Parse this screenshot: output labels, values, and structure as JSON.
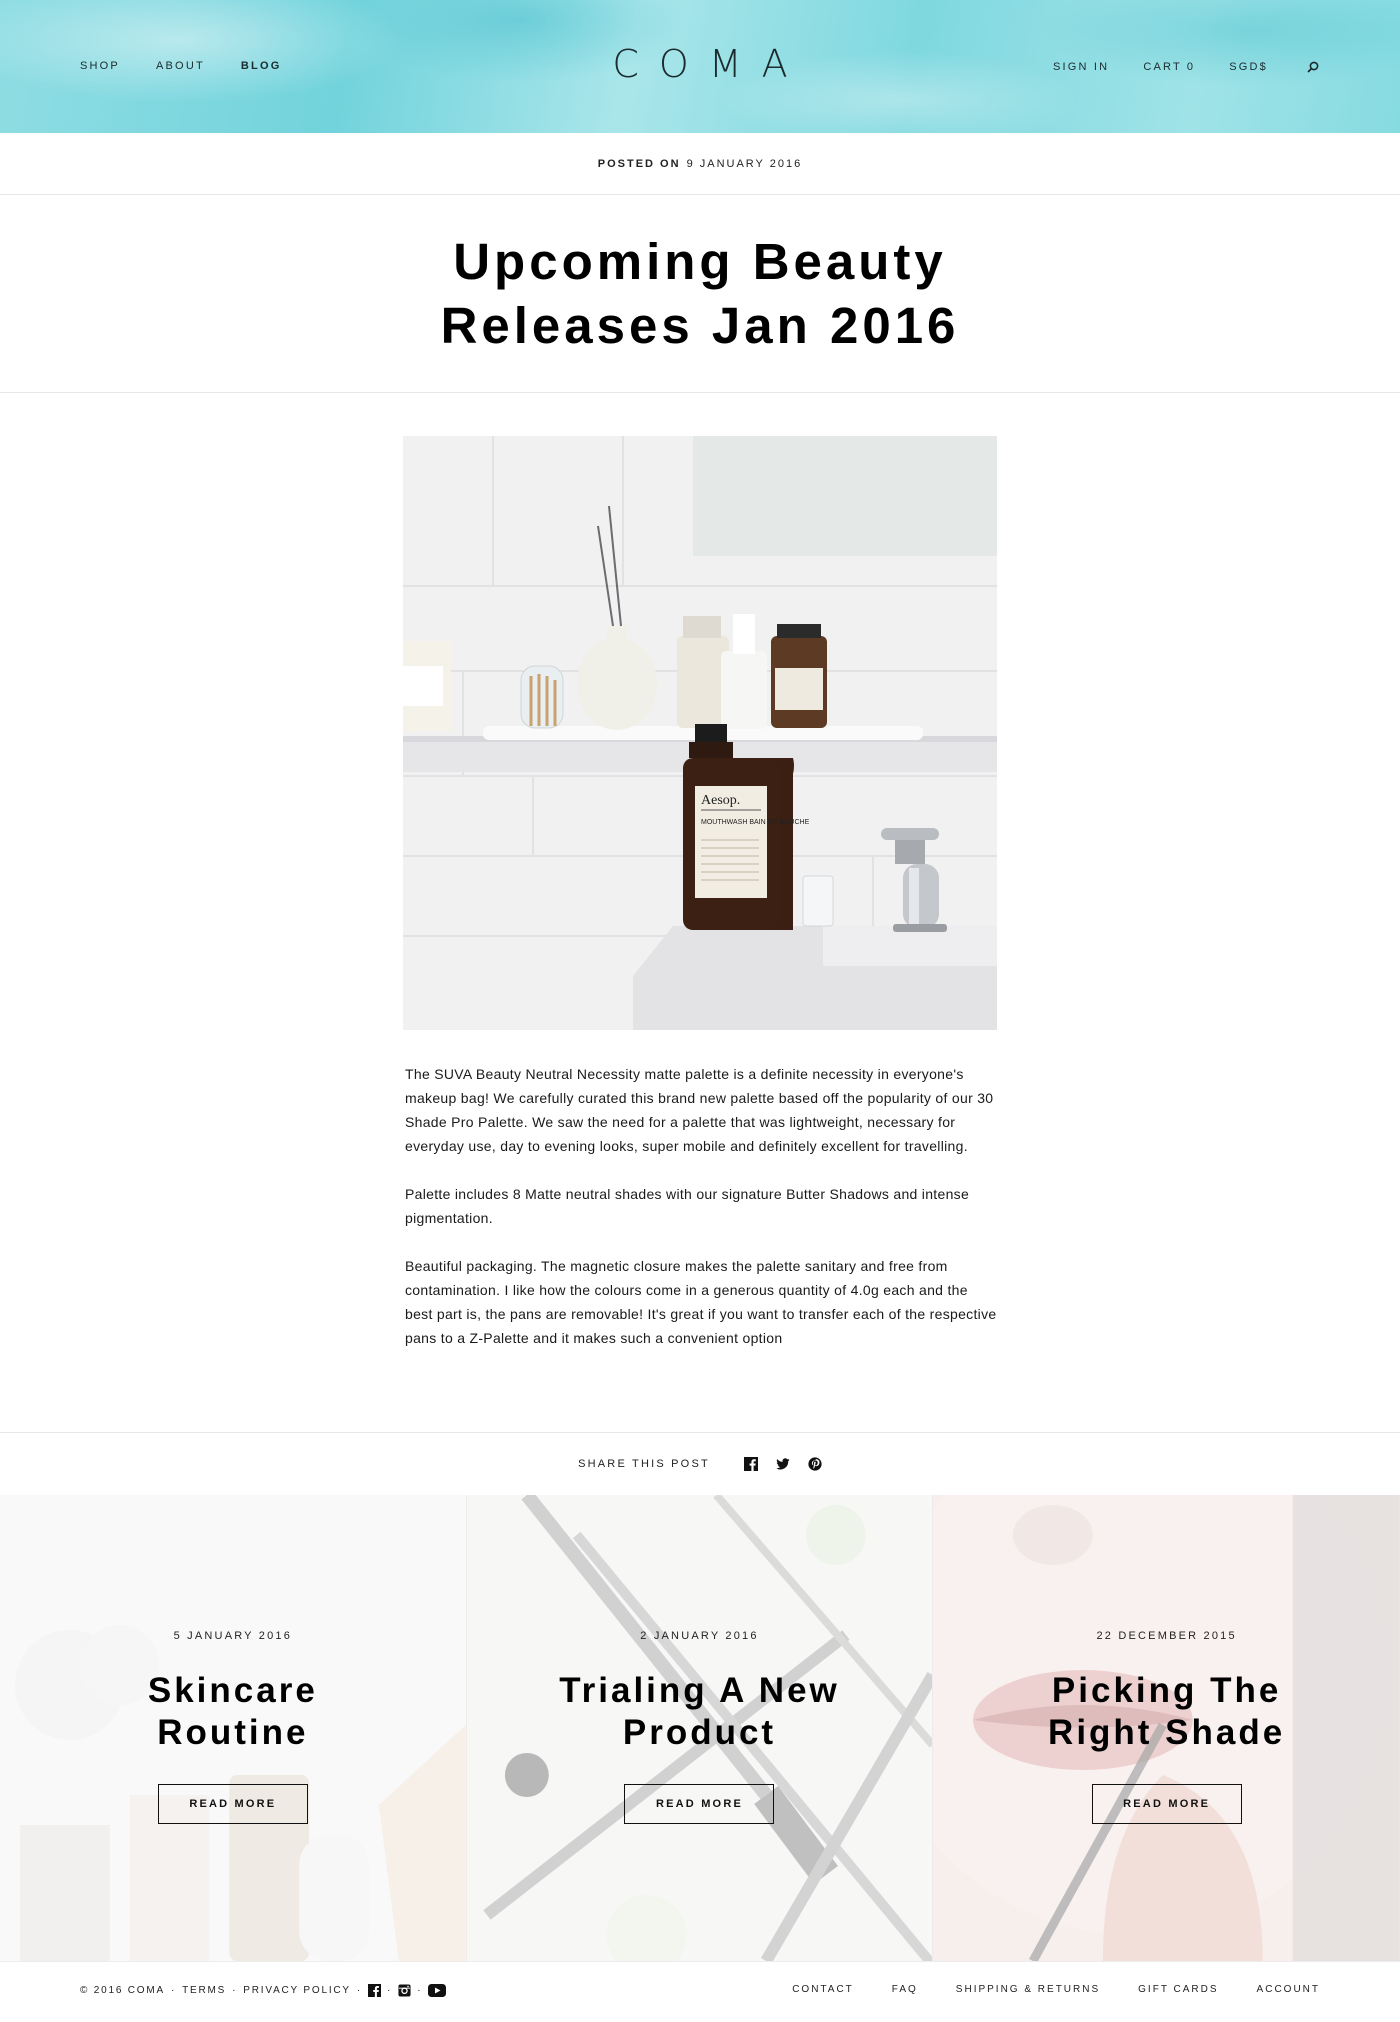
{
  "header": {
    "logo": "COMA",
    "nav_left": [
      "SHOP",
      "ABOUT",
      "BLOG"
    ],
    "active": "BLOG",
    "sign_in": "SIGN IN",
    "cart": "CART 0",
    "currency": "SGD$",
    "search_icon": "search-icon"
  },
  "post": {
    "posted_label": "POSTED ON",
    "date": "9 JANUARY 2016",
    "title": "Upcoming Beauty Releases Jan 2016",
    "image_bottle_label": "Aesop.",
    "image_bottle_text": "MOUTHWASH BAIN DE BOUCHE",
    "paragraphs": [
      "The SUVA Beauty Neutral Necessity matte palette is a definite necessity in everyone's makeup bag! We carefully curated this brand new palette based off the popularity of our 30 Shade Pro Palette. We saw the need for a palette that was lightweight, necessary for everyday use, day to evening looks, super mobile and definitely excellent for travelling.",
      "Palette includes 8 Matte neutral shades with our signature Butter Shadows and intense pigmentation.",
      "Beautiful packaging. The magnetic closure makes the palette sanitary and free from contamination. I like how the colours come in a generous quantity of 4.0g each and the best part is, the pans are removable! It's great if you want to transfer each of the respective pans to a Z-Palette and it makes such a convenient option"
    ]
  },
  "share": {
    "label": "SHARE THIS POST",
    "icons": [
      "facebook-icon",
      "twitter-icon",
      "pinterest-icon"
    ]
  },
  "related": [
    {
      "date": "5 JANUARY 2016",
      "title": "Skincare Routine",
      "button": "READ MORE"
    },
    {
      "date": "2 JANUARY 2016",
      "title": "Trialing A New Product",
      "button": "READ MORE"
    },
    {
      "date": "22 DECEMBER 2015",
      "title": "Picking The Right Shade",
      "button": "READ MORE"
    }
  ],
  "footer": {
    "copyright": "© 2016 COMA",
    "terms": "TERMS",
    "privacy": "PRIVACY POLICY",
    "social_icons": [
      "facebook-icon",
      "instagram-icon",
      "youtube-icon"
    ],
    "links": [
      "CONTACT",
      "FAQ",
      "SHIPPING & RETURNS",
      "GIFT CARDS",
      "ACCOUNT"
    ]
  },
  "colors": {
    "header_bg": "#86dbe1",
    "text": "#111111",
    "divider": "#e7e7e7"
  }
}
